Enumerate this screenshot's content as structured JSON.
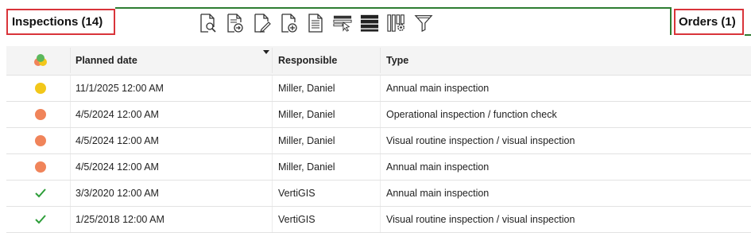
{
  "tabs": {
    "inspections": "Inspections (14)",
    "orders": "Orders (1)"
  },
  "toolbar": [
    {
      "icon": "view-document-icon"
    },
    {
      "icon": "export-document-icon"
    },
    {
      "icon": "edit-document-icon"
    },
    {
      "icon": "add-document-icon"
    },
    {
      "icon": "report-document-icon"
    },
    {
      "icon": "select-columns-icon"
    },
    {
      "icon": "list-view-icon"
    },
    {
      "icon": "column-settings-icon"
    },
    {
      "icon": "filter-icon"
    }
  ],
  "grid": {
    "columns": {
      "status": "",
      "planned_date": "Planned date",
      "responsible": "Responsible",
      "type": "Type"
    },
    "rows": [
      {
        "status": "due-soon",
        "status_color": "#f2c71a",
        "planned_date": "11/1/2025 12:00 AM",
        "responsible": "Miller, Daniel",
        "type": "Annual main inspection"
      },
      {
        "status": "overdue",
        "status_color": "#f0845a",
        "planned_date": "4/5/2024 12:00 AM",
        "responsible": "Miller, Daniel",
        "type": "Operational inspection / function check"
      },
      {
        "status": "overdue",
        "status_color": "#f0845a",
        "planned_date": "4/5/2024 12:00 AM",
        "responsible": "Miller, Daniel",
        "type": "Visual routine inspection / visual inspection"
      },
      {
        "status": "overdue",
        "status_color": "#f0845a",
        "planned_date": "4/5/2024 12:00 AM",
        "responsible": "Miller, Daniel",
        "type": "Annual main inspection"
      },
      {
        "status": "done",
        "status_color": "#2e9e3a",
        "planned_date": "3/3/2020 12:00 AM",
        "responsible": "VertiGIS",
        "type": "Annual main inspection"
      },
      {
        "status": "done",
        "status_color": "#2e9e3a",
        "planned_date": "1/25/2018 12:00 AM",
        "responsible": "VertiGIS",
        "type": "Visual routine inspection / visual inspection"
      }
    ]
  }
}
